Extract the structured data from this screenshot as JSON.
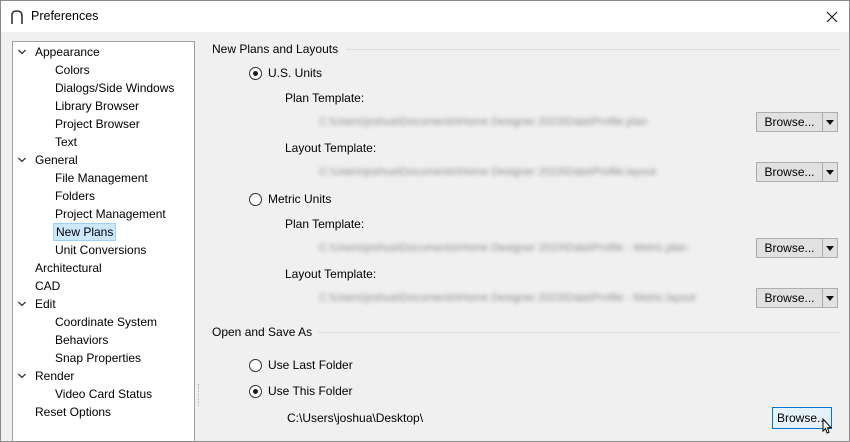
{
  "window": {
    "title": "Preferences"
  },
  "tree": [
    {
      "label": "Appearance",
      "level": 0,
      "expander": "expanded"
    },
    {
      "label": "Colors",
      "level": 1
    },
    {
      "label": "Dialogs/Side Windows",
      "level": 1
    },
    {
      "label": "Library Browser",
      "level": 1
    },
    {
      "label": "Project Browser",
      "level": 1
    },
    {
      "label": "Text",
      "level": 1
    },
    {
      "label": "General",
      "level": 0,
      "expander": "expanded"
    },
    {
      "label": "File Management",
      "level": 1
    },
    {
      "label": "Folders",
      "level": 1
    },
    {
      "label": "Project Management",
      "level": 1
    },
    {
      "label": "New Plans",
      "level": 1,
      "selected": true
    },
    {
      "label": "Unit Conversions",
      "level": 1
    },
    {
      "label": "Architectural",
      "level": 0
    },
    {
      "label": "CAD",
      "level": 0
    },
    {
      "label": "Edit",
      "level": 0,
      "expander": "expanded"
    },
    {
      "label": "Coordinate System",
      "level": 1
    },
    {
      "label": "Behaviors",
      "level": 1
    },
    {
      "label": "Snap Properties",
      "level": 1
    },
    {
      "label": "Render",
      "level": 0,
      "expander": "expanded"
    },
    {
      "label": "Video Card Status",
      "level": 1
    },
    {
      "label": "Reset Options",
      "level": 0
    }
  ],
  "new_plans": {
    "section_title": "New Plans and Layouts",
    "us_units": {
      "label": "U.S. Units",
      "checked": true,
      "plan_template_label": "Plan Template:",
      "plan_template_path": "C:\\Users\\joshua\\Documents\\Home Designer 2023\\Data\\Profile.plan",
      "layout_template_label": "Layout Template:",
      "layout_template_path": "C:\\Users\\joshua\\Documents\\Home Designer 2023\\Data\\Profile.layout"
    },
    "metric_units": {
      "label": "Metric Units",
      "checked": false,
      "plan_template_label": "Plan Template:",
      "plan_template_path": "C:\\Users\\joshua\\Documents\\Home Designer 2023\\Data\\Profile - Metric.plan",
      "layout_template_label": "Layout Template:",
      "layout_template_path": "C:\\Users\\joshua\\Documents\\Home Designer 2023\\Data\\Profile - Metric.layout"
    },
    "browse_label": "Browse..."
  },
  "open_save": {
    "section_title": "Open and Save As",
    "use_last_folder": {
      "label": "Use Last Folder",
      "checked": false
    },
    "use_this_folder": {
      "label": "Use This Folder",
      "checked": true
    },
    "folder_path": "C:\\Users\\joshua\\Desktop\\",
    "browse_label": "Browse..."
  },
  "icons": {
    "app": "arch-icon",
    "close": "close-icon",
    "tree_expander": "chevron-down-icon",
    "browse_dropdown": "triangle-down-icon",
    "cursor": "mouse-pointer-icon"
  },
  "colors": {
    "selection_bg": "#cce8ff",
    "selection_border": "#99d1ff",
    "dialog_bg": "#f0f0f0",
    "button_bg": "#e1e1e1",
    "button_hover_border": "#0078d7"
  }
}
